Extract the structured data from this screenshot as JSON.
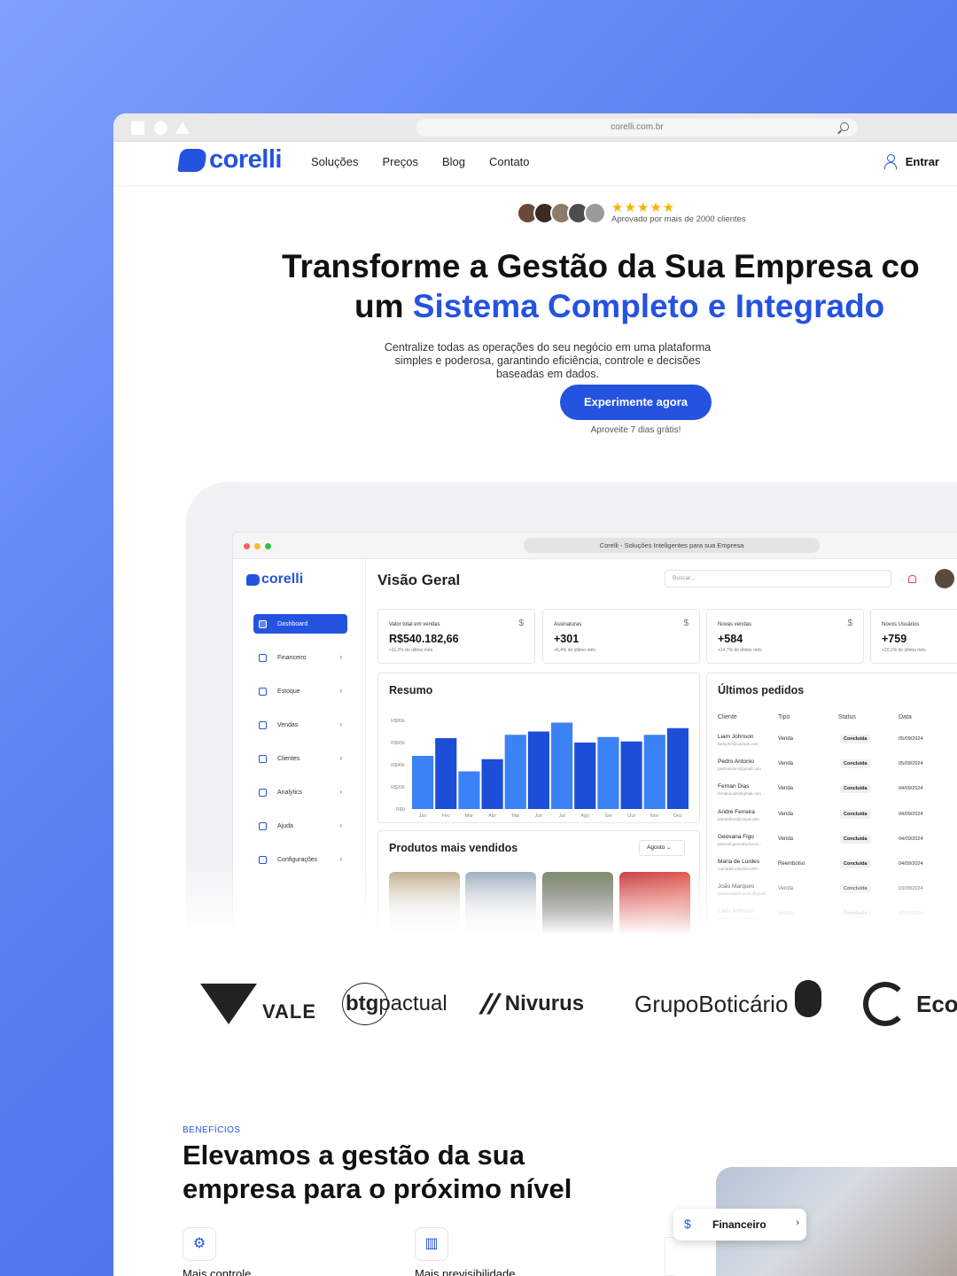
{
  "browser": {
    "url": "corelli.com.br"
  },
  "nav": {
    "logo": "corelli",
    "menu": [
      "Soluções",
      "Preços",
      "Blog",
      "Contato"
    ],
    "login": "Entrar"
  },
  "hero": {
    "stars": "★★★★★",
    "approval": "Aprovado por mais de 2000 clientes",
    "title_line1": "Transforme a Gestão da Sua Empresa co",
    "title_line2_prefix": "um ",
    "title_line2_highlight": "Sistema Completo e Integrado",
    "subtitle": "Centralize todas as operações do seu negócio em uma plataforma simples e poderosa, garantindo eficiência, controle e decisões baseadas em dados.",
    "cta": "Experimente agora",
    "cta_note": "Aproveite 7 dias grátis!"
  },
  "dashboard": {
    "window_title": "Corelli - Soluções Inteligentes para sua Empresa",
    "logo": "corelli",
    "sidebar": [
      "Dashboard",
      "Financeiro",
      "Estoque",
      "Vendas",
      "Clientes",
      "Analytics",
      "Ajuda",
      "Configurações"
    ],
    "page_title": "Visão Geral",
    "search_placeholder": "Buscar...",
    "kpis": [
      {
        "label": "Valor total em vendas",
        "value": "R$540.182,66",
        "change": "+11,2% do último mês"
      },
      {
        "label": "Assinaturas",
        "value": "+301",
        "change": "+6,4% do último mês"
      },
      {
        "label": "Novas vendas",
        "value": "+584",
        "change": "+14,7% do último mês"
      },
      {
        "label": "Novos Usuários",
        "value": "+759",
        "change": "+20,1% do último mês"
      }
    ],
    "summary_title": "Resumo",
    "products_title": "Produtos mais vendidos",
    "products_month": "Agosto",
    "orders_title": "Últimos pedidos",
    "orders_headers": [
      "Cliente",
      "Tipo",
      "Status",
      "Data"
    ],
    "orders": [
      {
        "name": "Liam Johnson",
        "email": "liamjohn@outlook.com",
        "type": "Venda",
        "status": "Concluída",
        "date": "05/09/2024"
      },
      {
        "name": "Pedro Antonio",
        "email": "pedroantoni@gmail.com",
        "type": "Venda",
        "status": "Concluída",
        "date": "05/09/2024"
      },
      {
        "name": "Fernan Dias",
        "email": "fernand.adv@gmail.com",
        "type": "Venda",
        "status": "Concluída",
        "date": "04/09/2024"
      },
      {
        "name": "André Ferreira",
        "email": "pandreferr@icloud.com",
        "type": "Venda",
        "status": "Concluída",
        "date": "04/09/2024"
      },
      {
        "name": "Geovana Figo",
        "email": "pessoal.geovana.livros...",
        "type": "Venda",
        "status": "Concluída",
        "date": "04/09/2024"
      },
      {
        "name": "Maria de Lurdes",
        "email": "mariadelurdesfive1957...",
        "type": "Reembolso",
        "status": "Concluída",
        "date": "04/09/2024"
      },
      {
        "name": "João Marques",
        "email": "joaomarques.vivian@gmail",
        "type": "Venda",
        "status": "Concluída",
        "date": "03/09/2024"
      },
      {
        "name": "Liam Johnson",
        "email": "johnsonrodrigues01@bl...",
        "type": "Venda",
        "status": "Concluída",
        "date": "02/09/2024"
      }
    ]
  },
  "chart_data": {
    "type": "bar",
    "title": "Resumo",
    "categories": [
      "Jan",
      "Fev",
      "Mar",
      "Abr",
      "Mai",
      "Jun",
      "Jul",
      "Ago",
      "Set",
      "Out",
      "Nov",
      "Dez"
    ],
    "values": [
      48,
      64,
      34,
      45,
      67,
      70,
      78,
      60,
      65,
      61,
      67,
      73
    ],
    "yticks": [
      "R$0",
      "R$20k",
      "R$40k",
      "R$60k",
      "R$80k"
    ],
    "ylim": [
      0,
      80
    ],
    "colors": [
      "#3b82f6",
      "#1d4ed8"
    ]
  },
  "logos": [
    "VALE",
    "btg",
    "pactual",
    "Nivurus",
    "GrupoBoticário",
    "Eco"
  ],
  "benefits": {
    "tag": "BENEFÍCIOS",
    "title": "Elevamos a gestão da sua empresa para o próximo nível",
    "features": [
      "Mais controle",
      "Mais previsibilidade"
    ],
    "card_label": "Financeiro"
  },
  "colors": {
    "brand": "#2453e0",
    "background": "#5a80f0"
  }
}
